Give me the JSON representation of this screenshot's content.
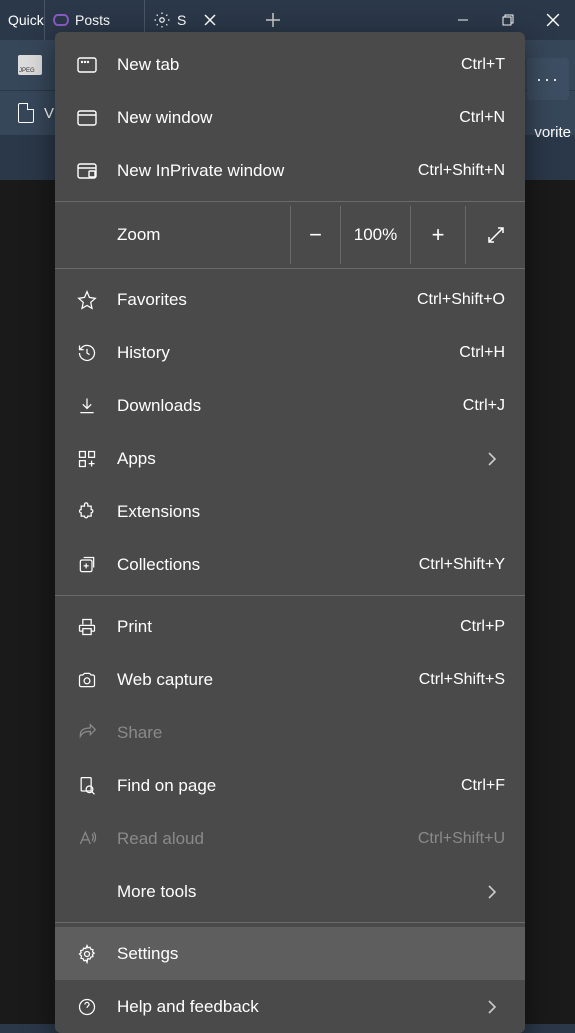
{
  "titlebar": {
    "tab_quick": "Quick",
    "tab_posts": "Posts",
    "tab_settings": "S"
  },
  "toolbar": {
    "favorites": "vorite",
    "second_letter": "V"
  },
  "menu": {
    "new_tab": {
      "label": "New tab",
      "shortcut": "Ctrl+T"
    },
    "new_window": {
      "label": "New window",
      "shortcut": "Ctrl+N"
    },
    "new_inprivate": {
      "label": "New InPrivate window",
      "shortcut": "Ctrl+Shift+N"
    },
    "zoom": {
      "label": "Zoom",
      "value": "100%"
    },
    "favorites": {
      "label": "Favorites",
      "shortcut": "Ctrl+Shift+O"
    },
    "history": {
      "label": "History",
      "shortcut": "Ctrl+H"
    },
    "downloads": {
      "label": "Downloads",
      "shortcut": "Ctrl+J"
    },
    "apps": {
      "label": "Apps"
    },
    "extensions": {
      "label": "Extensions"
    },
    "collections": {
      "label": "Collections",
      "shortcut": "Ctrl+Shift+Y"
    },
    "print": {
      "label": "Print",
      "shortcut": "Ctrl+P"
    },
    "web_capture": {
      "label": "Web capture",
      "shortcut": "Ctrl+Shift+S"
    },
    "share": {
      "label": "Share"
    },
    "find": {
      "label": "Find on page",
      "shortcut": "Ctrl+F"
    },
    "read_aloud": {
      "label": "Read aloud",
      "shortcut": "Ctrl+Shift+U"
    },
    "more_tools": {
      "label": "More tools"
    },
    "settings": {
      "label": "Settings"
    },
    "help": {
      "label": "Help and feedback"
    }
  }
}
